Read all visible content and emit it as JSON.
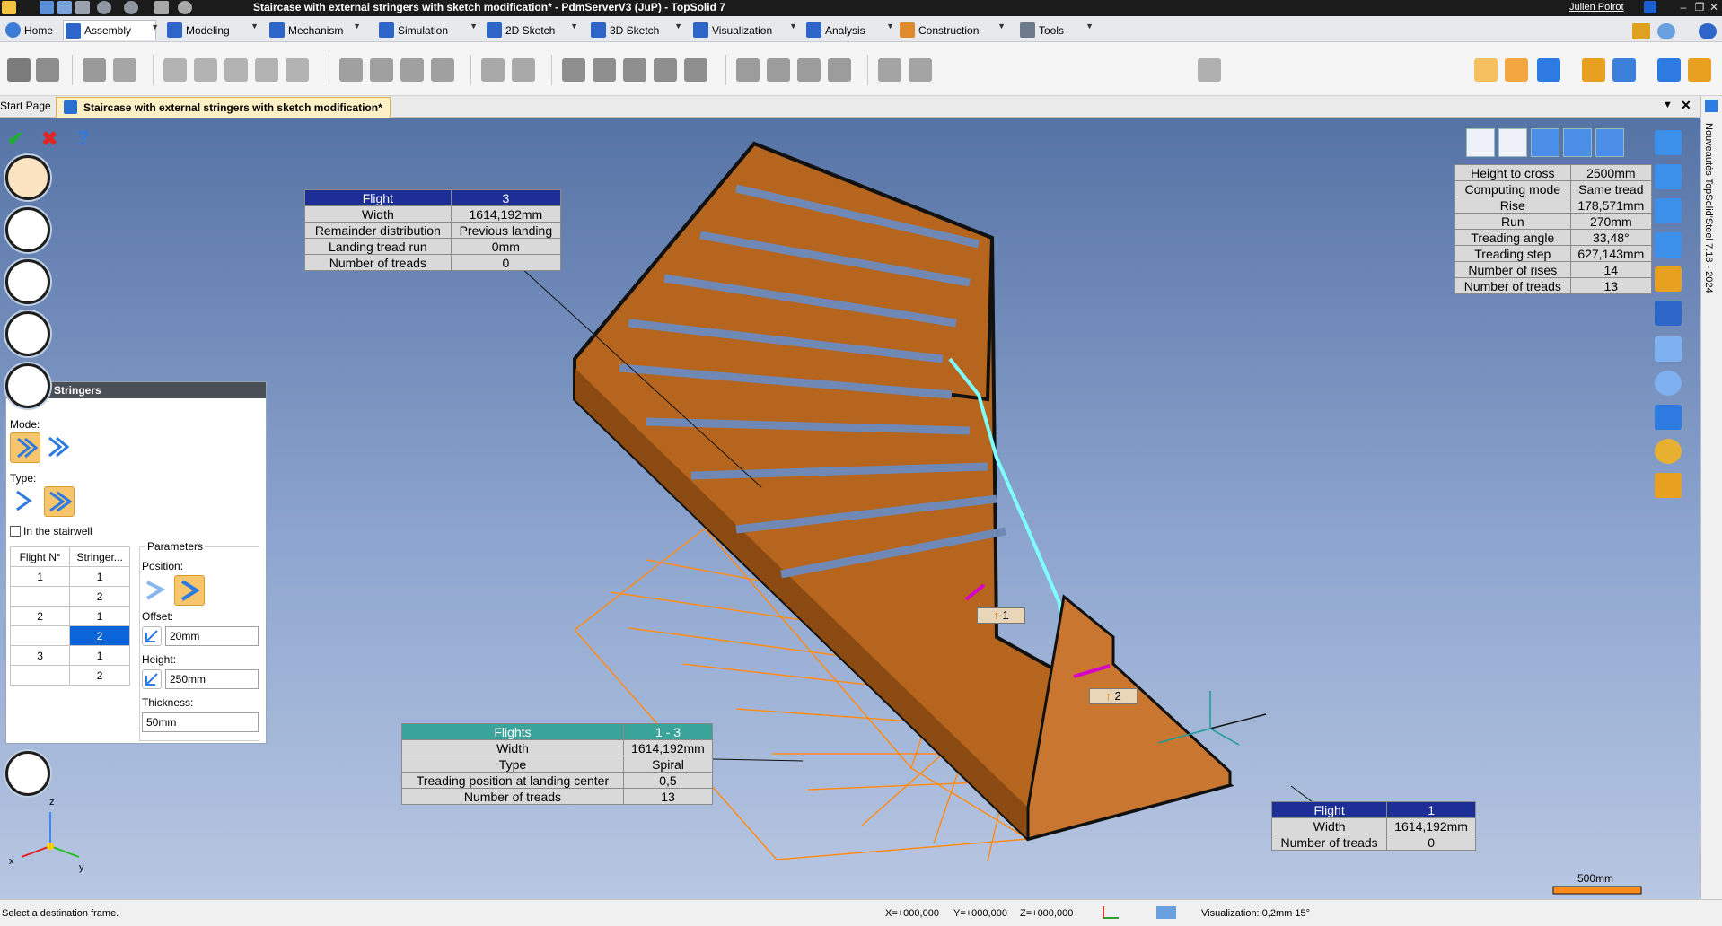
{
  "window": {
    "title": "Staircase with external stringers with sketch modification* - PdmServerV3 (JuP) - TopSolid 7",
    "user": "Julien Poirot"
  },
  "ribbon_tabs": [
    {
      "label": "Home"
    },
    {
      "label": "Assembly"
    },
    {
      "label": "Modeling"
    },
    {
      "label": "Mechanism"
    },
    {
      "label": "Simulation"
    },
    {
      "label": "2D Sketch"
    },
    {
      "label": "3D Sketch"
    },
    {
      "label": "Visualization"
    },
    {
      "label": "Analysis"
    },
    {
      "label": "Construction"
    },
    {
      "label": "Tools"
    }
  ],
  "doc_tabs": {
    "start": "Start Page",
    "active": "Staircase with external stringers with sketch modification*"
  },
  "side_strip_text": "Nouveautés TopSolid'Steel 7.18 - 2024",
  "stringers_panel": {
    "title": "Stringers",
    "mode_label": "Mode:",
    "type_label": "Type:",
    "in_stairwell_label": "In the stairwell",
    "grid_headers": [
      "Flight N°",
      "Stringer..."
    ],
    "grid_rows": [
      [
        "1",
        "1"
      ],
      [
        "",
        "2"
      ],
      [
        "2",
        "1"
      ],
      [
        "",
        "2"
      ],
      [
        "3",
        "1"
      ],
      [
        "",
        "2"
      ]
    ],
    "parameters_label": "Parameters",
    "position_label": "Position:",
    "offset_label": "Offset:",
    "offset_value": "20mm",
    "height_label": "Height:",
    "height_value": "250mm",
    "thickness_label": "Thickness:",
    "thickness_value": "50mm"
  },
  "table_flight3": {
    "rows": [
      [
        "Flight",
        "3"
      ],
      [
        "Width",
        "1614,192mm"
      ],
      [
        "Remainder distribution",
        "Previous landing"
      ],
      [
        "Landing tread run",
        "0mm"
      ],
      [
        "Number of treads",
        "0"
      ]
    ]
  },
  "table_global": {
    "rows": [
      [
        "Height to cross",
        "2500mm"
      ],
      [
        "Computing mode",
        "Same tread"
      ],
      [
        "Rise",
        "178,571mm"
      ],
      [
        "Run",
        "270mm"
      ],
      [
        "Treading angle",
        "33,48°"
      ],
      [
        "Treading step",
        "627,143mm"
      ],
      [
        "Number of rises",
        "14"
      ],
      [
        "Number of treads",
        "13"
      ]
    ]
  },
  "table_flights": {
    "rows": [
      [
        "Flights",
        "1 - 3"
      ],
      [
        "Width",
        "1614,192mm"
      ],
      [
        "Type",
        "Spiral"
      ],
      [
        "Treading position at landing center",
        "0,5"
      ],
      [
        "Number of treads",
        "13"
      ]
    ]
  },
  "table_flight1": {
    "rows": [
      [
        "Flight",
        "1"
      ],
      [
        "Width",
        "1614,192mm"
      ],
      [
        "Number of treads",
        "0"
      ]
    ]
  },
  "markers": {
    "m1": "1",
    "m2": "2"
  },
  "scale_label": "500mm",
  "axis_labels": {
    "x": "x",
    "y": "y",
    "z": "z"
  },
  "status": {
    "message": "Select a destination frame.",
    "x": "X=+000,000",
    "y": "Y=+000,000",
    "z": "Z=+000,000",
    "visualization": "Visualization: 0,2mm 15°"
  },
  "colors": {
    "wood": "#b5651d",
    "wood_dark": "#8a4a12",
    "sketch": "#ff8c1a",
    "highlight": "#7fffff",
    "header_blue": "#1d2f96",
    "header_teal": "#3aa39a"
  }
}
